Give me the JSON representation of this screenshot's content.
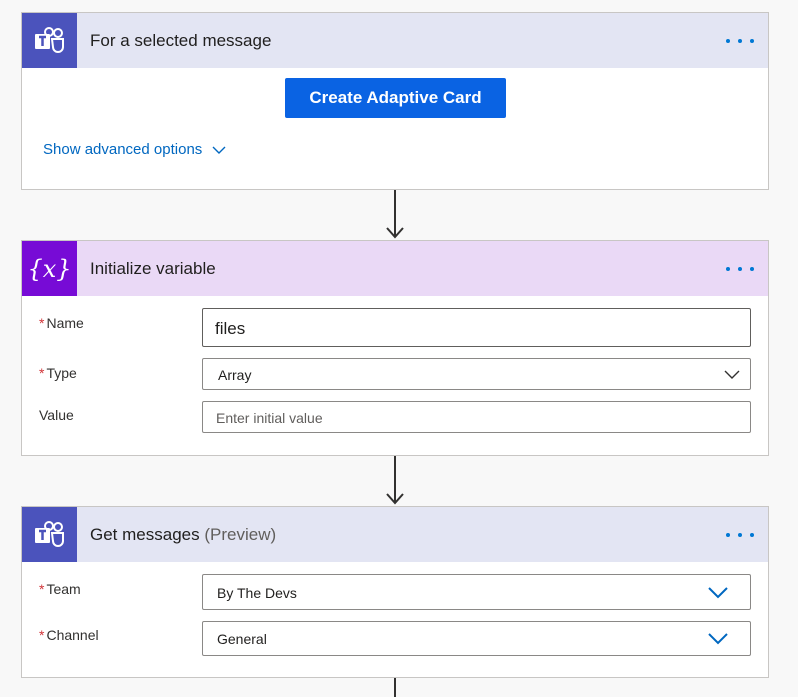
{
  "card1": {
    "title": "For a selected message",
    "button_label": "Create Adaptive Card",
    "advanced_link": "Show advanced options",
    "accent": "#4b53bc",
    "header_bg": "#e3e5f3"
  },
  "card2": {
    "title": "Initialize variable",
    "icon_glyph": "{x}",
    "accent": "#770bd6",
    "header_bg": "#ead9f6",
    "fields": {
      "name_label": "Name",
      "name_value": "files",
      "type_label": "Type",
      "type_value": "Array",
      "value_label": "Value",
      "value_placeholder": "Enter initial value"
    }
  },
  "card3": {
    "title": "Get messages",
    "title_suffix": "(Preview)",
    "accent": "#4b53bc",
    "header_bg": "#e3e5f3",
    "fields": {
      "team_label": "Team",
      "team_value": "By The Devs",
      "channel_label": "Channel",
      "channel_value": "General"
    }
  },
  "required_marker": "*"
}
